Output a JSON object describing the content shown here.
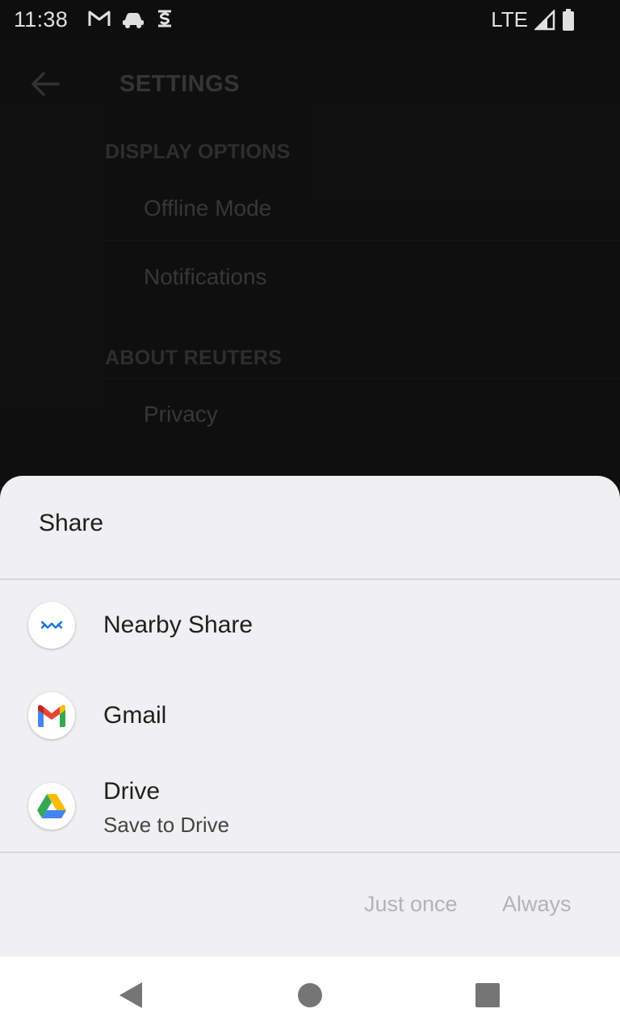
{
  "status_bar": {
    "time": "11:38",
    "network": "LTE",
    "icons_left": [
      "gmail-icon",
      "car-icon",
      "sync-icon"
    ],
    "icons_right": [
      "signal-icon",
      "battery-icon"
    ]
  },
  "settings": {
    "title": "SETTINGS",
    "sections": [
      {
        "header": "DISPLAY OPTIONS",
        "items": [
          "Offline Mode",
          "Notifications"
        ]
      },
      {
        "header": "ABOUT REUTERS",
        "items": [
          "Privacy"
        ]
      }
    ]
  },
  "share_sheet": {
    "title": "Share",
    "targets": [
      {
        "label": "Nearby Share",
        "icon": "nearby-share-icon"
      },
      {
        "label": "Gmail",
        "icon": "gmail-icon"
      },
      {
        "label": "Drive",
        "sublabel": "Save to Drive",
        "icon": "drive-icon"
      }
    ],
    "buttons": {
      "just_once": "Just once",
      "always": "Always"
    }
  },
  "colors": {
    "sheet_bg": "#f0f0f2",
    "background": "#121212",
    "disabled_text": "#b3b3b5",
    "nearby_blue": "#1a73e8"
  },
  "nav_bar": {
    "buttons": [
      "back-icon",
      "home-icon",
      "recents-icon"
    ]
  }
}
